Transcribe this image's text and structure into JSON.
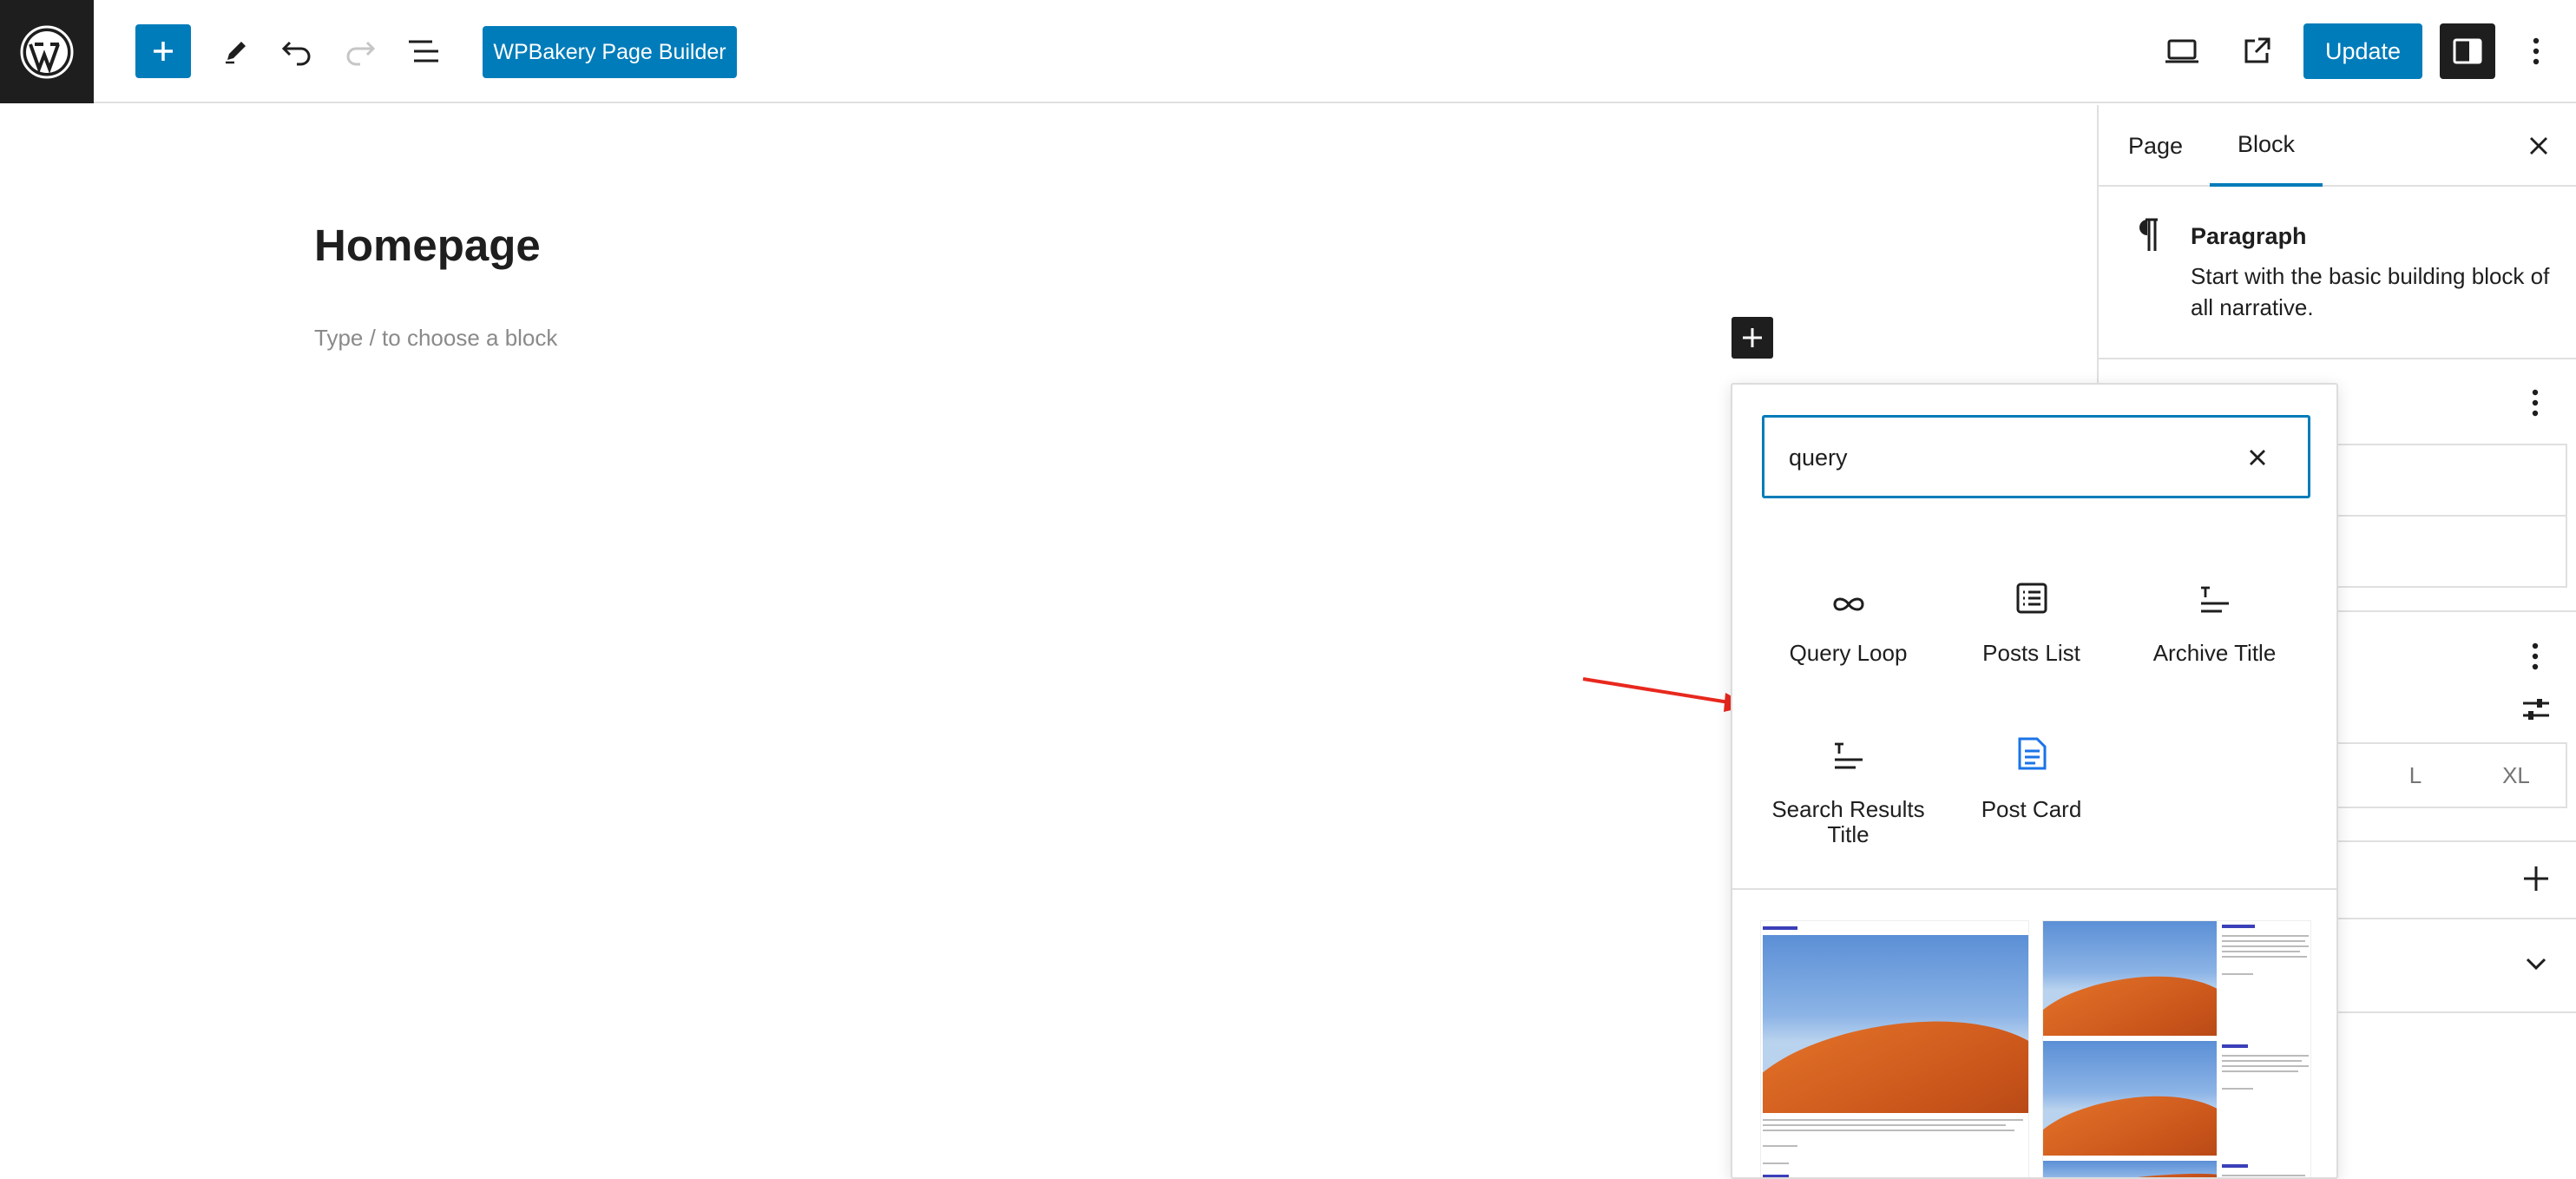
{
  "toolbar": {
    "wpbakery_label": "WPBakery Page Builder",
    "update_label": "Update",
    "icons": [
      "wordpress-logo",
      "plus-icon",
      "pencil-icon",
      "undo-icon",
      "redo-icon",
      "list-view-icon",
      "desktop-preview-icon",
      "external-link-icon",
      "sidebar-toggle-icon",
      "more-vertical-icon"
    ]
  },
  "canvas": {
    "title": "Homepage",
    "placeholder": "Type / to choose a block"
  },
  "sidebar": {
    "tabs": [
      {
        "label": "Page"
      },
      {
        "label": "Block"
      }
    ],
    "active_tab": "Block",
    "block_card": {
      "title": "Paragraph",
      "description": "Start with the basic building block of all narrative."
    },
    "sizes": [
      "L",
      "XL"
    ]
  },
  "inserter": {
    "search_value": "query",
    "results": [
      {
        "label": "Query Loop",
        "icon": "loop-icon"
      },
      {
        "label": "Posts List",
        "icon": "posts-list-icon"
      },
      {
        "label": "Archive Title",
        "icon": "title-icon"
      },
      {
        "label": "Search Results Title",
        "icon": "title-icon"
      },
      {
        "label": "Post Card",
        "icon": "post-card-icon"
      }
    ]
  },
  "colors": {
    "accent": "#007cba",
    "dark": "#1e1e1e",
    "annotation_arrow": "#e8281e"
  }
}
